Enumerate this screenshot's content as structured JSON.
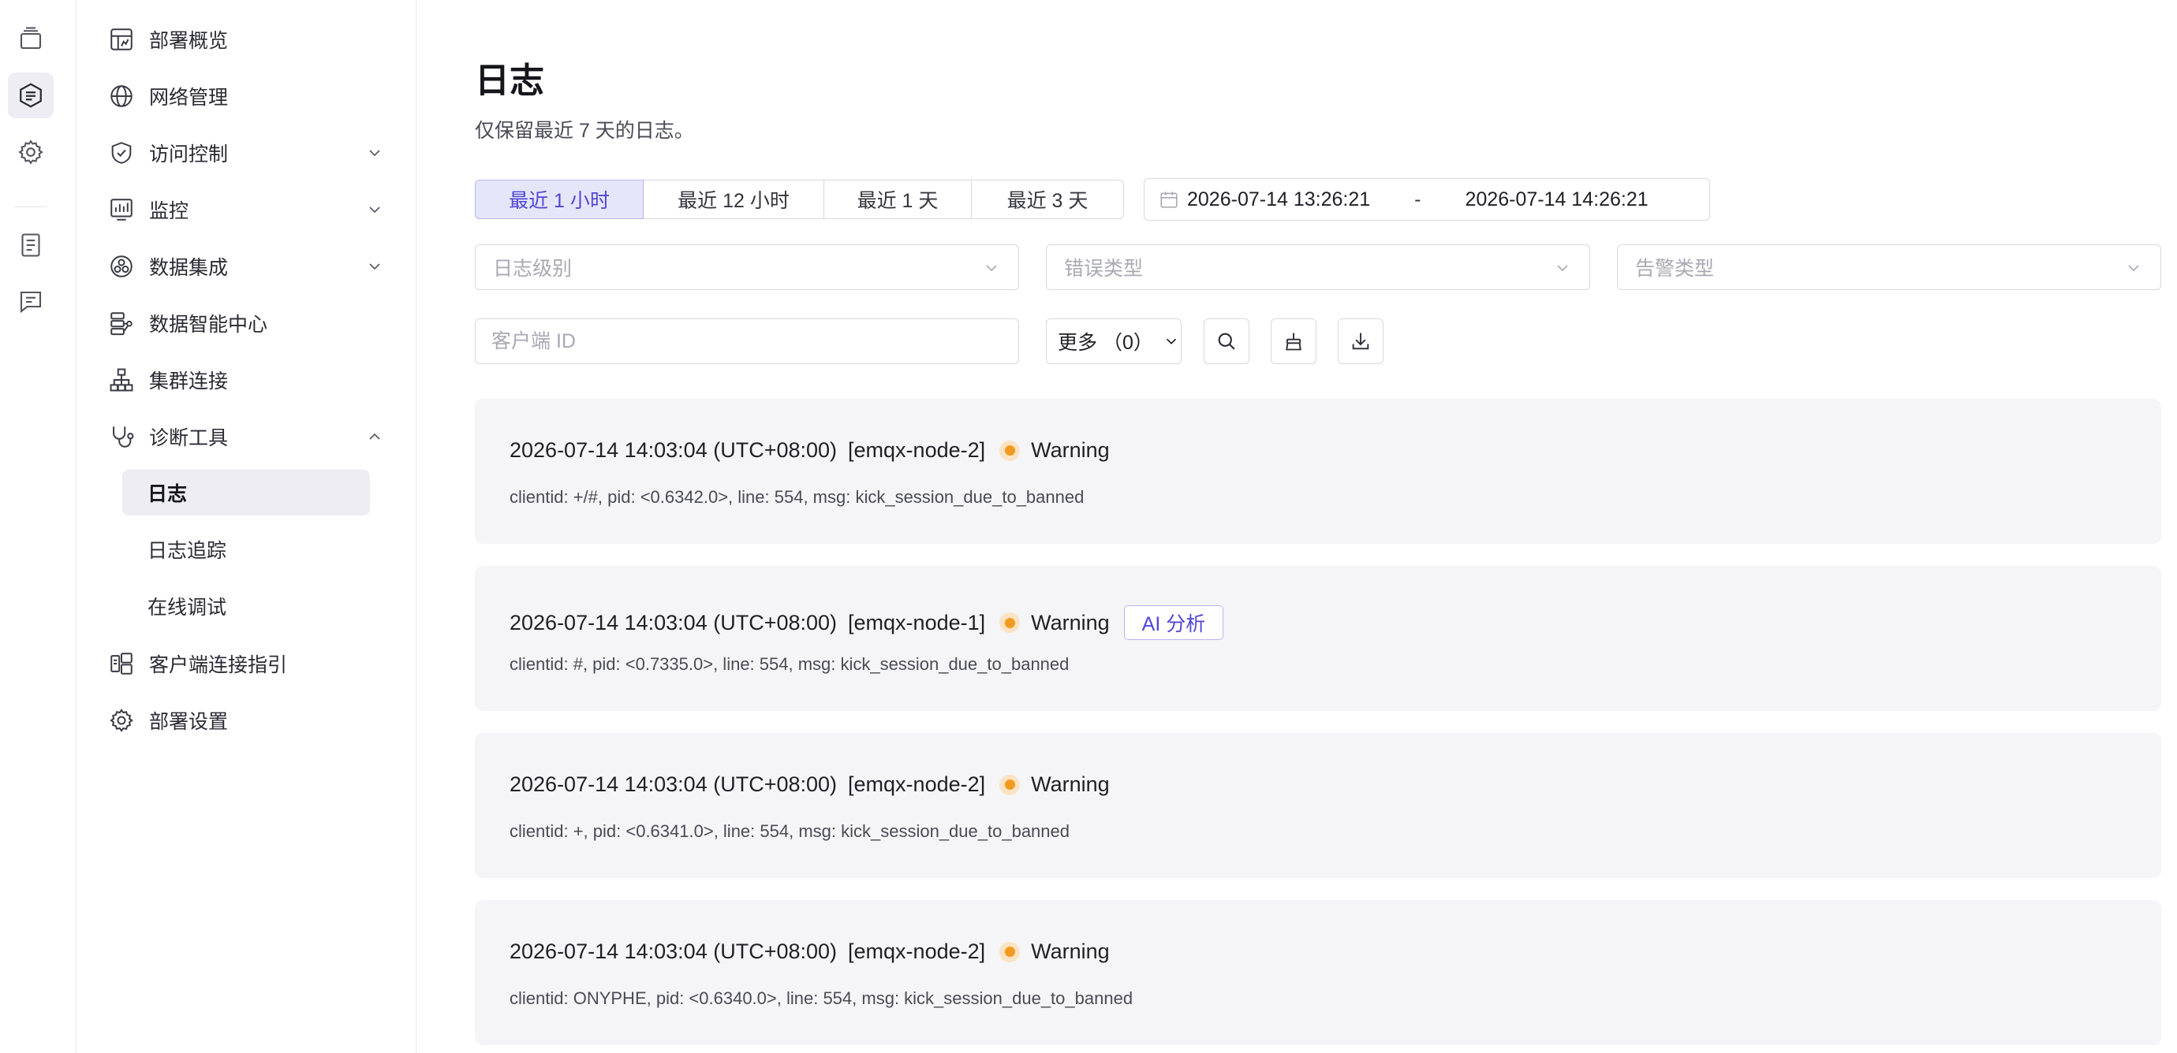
{
  "sidebar": {
    "items": [
      {
        "label": "部署概览",
        "icon": "dashboard-icon"
      },
      {
        "label": "网络管理",
        "icon": "network-icon"
      },
      {
        "label": "访问控制",
        "icon": "shield-icon",
        "expandable": true
      },
      {
        "label": "监控",
        "icon": "monitor-chart-icon",
        "expandable": true
      },
      {
        "label": "数据集成",
        "icon": "integration-icon",
        "expandable": true
      },
      {
        "label": "数据智能中心",
        "icon": "data-intelligence-icon"
      },
      {
        "label": "集群连接",
        "icon": "cluster-icon"
      },
      {
        "label": "诊断工具",
        "icon": "stethoscope-icon",
        "expanded": true
      },
      {
        "label": "客户端连接指引",
        "icon": "client-guide-icon"
      },
      {
        "label": "部署设置",
        "icon": "gear-icon"
      }
    ],
    "subitems": [
      {
        "label": "日志",
        "active": true
      },
      {
        "label": "日志追踪"
      },
      {
        "label": "在线调试"
      }
    ]
  },
  "page": {
    "title": "日志",
    "subtitle": "仅保留最近 7 天的日志。"
  },
  "filters": {
    "ranges": [
      "最近 1 小时",
      "最近 12 小时",
      "最近 1 天",
      "最近 3 天"
    ],
    "active_range": 0,
    "start": "2026-07-14 13:26:21",
    "range_sep": "-",
    "end": "2026-07-14 14:26:21",
    "level_placeholder": "日志级别",
    "error_type_placeholder": "错误类型",
    "alarm_type_placeholder": "告警类型",
    "client_placeholder": "客户端 ID",
    "more_label": "更多 （0）"
  },
  "logs": [
    {
      "time": "2026-07-14 14:03:04 (UTC+08:00)",
      "node": "[emqx-node-2]",
      "level": "Warning",
      "msg": "clientid: +/#, pid: <0.6342.0>, line: 554, msg: kick_session_due_to_banned"
    },
    {
      "time": "2026-07-14 14:03:04 (UTC+08:00)",
      "node": "[emqx-node-1]",
      "level": "Warning",
      "ai": "AI 分析",
      "msg": "clientid: #, pid: <0.7335.0>, line: 554, msg: kick_session_due_to_banned"
    },
    {
      "time": "2026-07-14 14:03:04 (UTC+08:00)",
      "node": "[emqx-node-2]",
      "level": "Warning",
      "msg": "clientid: +, pid: <0.6341.0>, line: 554, msg: kick_session_due_to_banned"
    },
    {
      "time": "2026-07-14 14:03:04 (UTC+08:00)",
      "node": "[emqx-node-2]",
      "level": "Warning",
      "msg": "clientid: ONYPHE, pid: <0.6340.0>, line: 554, msg: kick_session_due_to_banned"
    }
  ],
  "colors": {
    "accent": "#5046d6",
    "accent_bg": "#e6e6fb",
    "warning": "#f29a1f",
    "card_bg": "#f5f5f8"
  }
}
